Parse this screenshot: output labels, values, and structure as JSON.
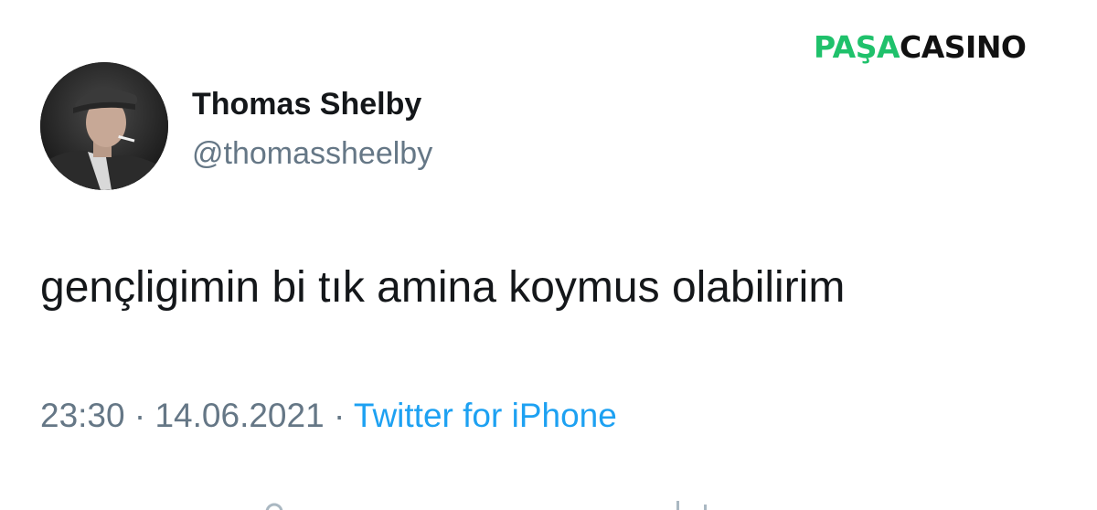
{
  "watermark": {
    "part1": "PAŞA",
    "part2": "CASINO",
    "color_green": "#1fc16b",
    "color_black": "#111111"
  },
  "tweet": {
    "author": {
      "display_name": "Thomas Shelby",
      "handle": "@thomassheelby",
      "avatar_icon": "profile-photo"
    },
    "text": "gençligimin bi tık amina koymus olabilirim",
    "meta": {
      "time": "23:30",
      "date": "14.06.2021",
      "separator": "·",
      "source": "Twitter for iPhone"
    }
  },
  "colors": {
    "text_primary": "#14171a",
    "text_secondary": "#657786",
    "link": "#1da1f2"
  }
}
